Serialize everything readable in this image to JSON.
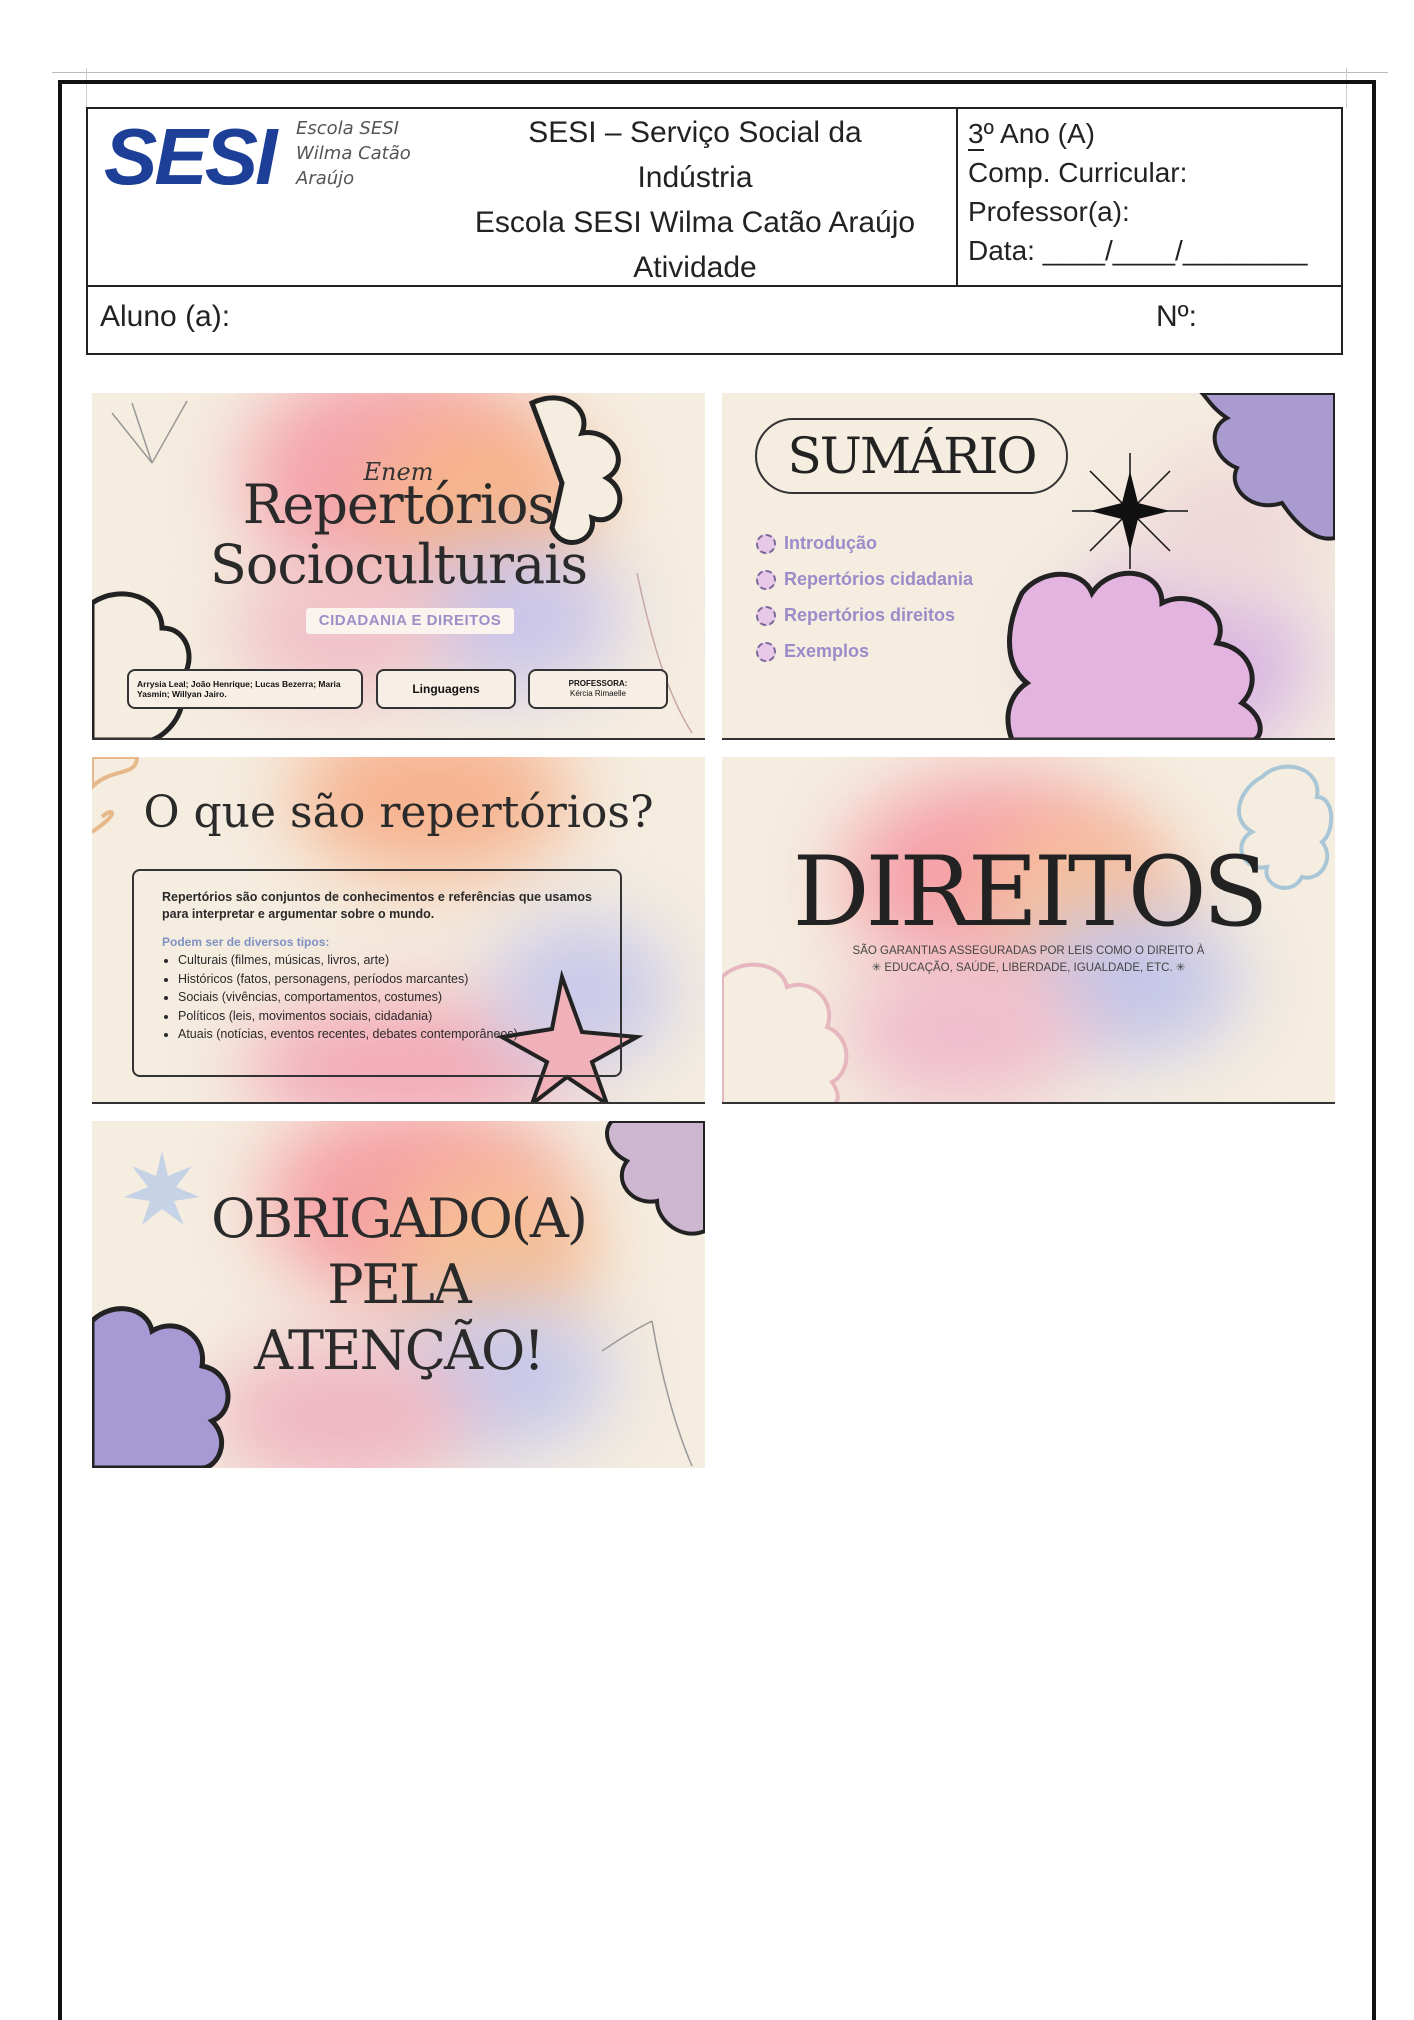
{
  "header": {
    "logo_mark": "SESI",
    "logo_lines": [
      "Escola SESI",
      "Wilma Catão",
      "Araújo"
    ],
    "center_lines": [
      "SESI – Serviço Social da",
      "Indústria",
      "Escola SESI Wilma Catão Araújo",
      "Atividade"
    ],
    "year_number": "3",
    "year_rest": "º Ano (A)",
    "comp_curricular": "Comp. Curricular:",
    "professor": "Professor(a):",
    "data": "Data: ____/____/________",
    "aluno": "Aluno (a):",
    "numero": "Nº:"
  },
  "slides": {
    "s1": {
      "enem": "Enem",
      "title_line1": "Repertórios",
      "title_line2": "Socioculturais",
      "tag": "CIDADANIA E DIREITOS",
      "students": "Arrysia Leal; João Henrique; Lucas Bezerra; Maria Yasmin; Willyan Jairo.",
      "subject": "Linguagens",
      "professor_label": "PROFESSORA:",
      "professor_name": "Kércia Rimaelle"
    },
    "s2": {
      "title": "SUMÁRIO",
      "items": [
        "Introdução",
        "Repertórios cidadania",
        "Repertórios direitos",
        "Exemplos"
      ]
    },
    "s3": {
      "title": "O que são repertórios?",
      "intro": "Repertórios são conjuntos de conhecimentos e referências que usamos para interpretar e argumentar sobre o mundo.",
      "subtitle": "Podem ser de diversos tipos:",
      "list": [
        "Culturais (filmes, músicas, livros, arte)",
        "Históricos (fatos, personagens, períodos marcantes)",
        "Sociais (vivências, comportamentos, costumes)",
        "Políticos (leis, movimentos sociais, cidadania)",
        "Atuais (notícias, eventos recentes, debates contemporâneos)"
      ]
    },
    "s4": {
      "title": "DIREITOS",
      "sub_line1": "SÃO GARANTIAS ASSEGURADAS POR LEIS COMO O DIREITO À",
      "sub_line2": "✳ EDUCAÇÃO, SAÚDE, LIBERDADE, IGUALDADE, ETC. ✳"
    },
    "s5": {
      "line1": "OBRIGADO(A)",
      "line2": "PELA",
      "line3": "ATENÇÃO!"
    }
  },
  "colors": {
    "logo_blue": "#1e3f97",
    "lavender": "#9a8cc9",
    "slide_bg": "#f5ede0",
    "pink": "#f2a5b5",
    "peach": "#f5b98a"
  }
}
